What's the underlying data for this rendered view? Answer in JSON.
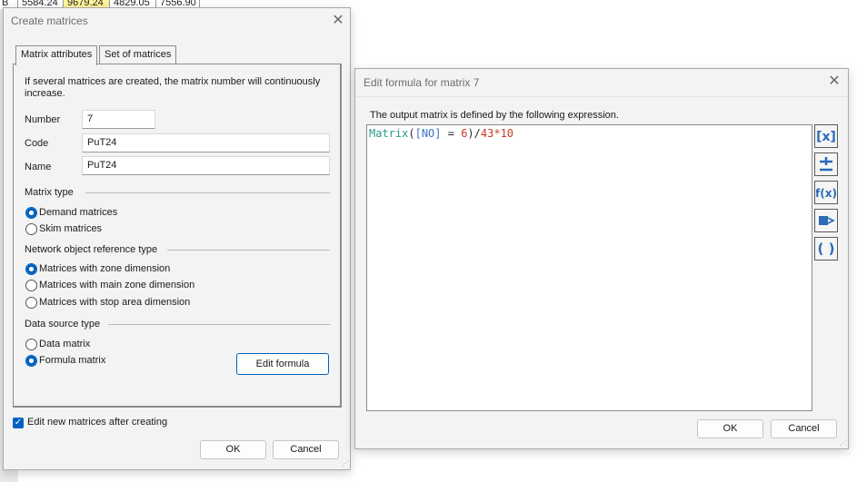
{
  "background": {
    "row_label": "B",
    "cells": [
      "5584.24",
      "9679.24",
      "4829.05",
      "7556.90"
    ]
  },
  "create_dialog": {
    "title": "Create matrices",
    "tabs": [
      {
        "label": "Matrix attributes",
        "active": true
      },
      {
        "label": "Set of matrices",
        "active": false
      }
    ],
    "info_text_line1": "If several matrices are created, the matrix number will continuously",
    "info_text_line2": "increase.",
    "number": {
      "label": "Number",
      "value": "7"
    },
    "code": {
      "label": "Code",
      "value": "PuT24"
    },
    "name": {
      "label": "Name",
      "value": "PuT24"
    },
    "matrix_type": {
      "heading": "Matrix type",
      "options": [
        {
          "label": "Demand matrices",
          "selected": true
        },
        {
          "label": "Skim matrices",
          "selected": false
        }
      ]
    },
    "reference_type": {
      "heading": "Network object reference type",
      "options": [
        {
          "label": "Matrices with zone dimension",
          "selected": true
        },
        {
          "label": "Matrices with main zone dimension",
          "selected": false
        },
        {
          "label": "Matrices with stop area dimension",
          "selected": false
        }
      ]
    },
    "data_source": {
      "heading": "Data source type",
      "options": [
        {
          "label": "Data matrix",
          "selected": false
        },
        {
          "label": "Formula matrix",
          "selected": true
        }
      ],
      "edit_formula_label": "Edit formula"
    },
    "edit_after_create": {
      "label": "Edit new matrices after creating",
      "checked": true
    },
    "ok_label": "OK",
    "cancel_label": "Cancel"
  },
  "formula_dialog": {
    "title": "Edit formula for matrix 7",
    "description": "The output matrix is defined by the following expression.",
    "expression_tokens": [
      {
        "text": "Matrix",
        "kind": "fn"
      },
      {
        "text": "(",
        "kind": "op"
      },
      {
        "text": "[NO]",
        "kind": "attr"
      },
      {
        "text": " = ",
        "kind": "op"
      },
      {
        "text": "6",
        "kind": "num"
      },
      {
        "text": ")/",
        "kind": "op"
      },
      {
        "text": "43",
        "kind": "num"
      },
      {
        "text": "*",
        "kind": "op"
      },
      {
        "text": "10",
        "kind": "num"
      }
    ],
    "side_buttons": [
      "insert-attribute-icon",
      "plus-minus-icon",
      "function-icon",
      "insert-matrix-icon",
      "parentheses-icon"
    ],
    "ok_label": "OK",
    "cancel_label": "Cancel"
  },
  "colors": {
    "accent": "#0060c0",
    "formula_function": "#2b9a8f",
    "formula_attribute": "#3a73c4",
    "formula_number": "#c83a20",
    "highlight_cell": "#fff59a"
  }
}
